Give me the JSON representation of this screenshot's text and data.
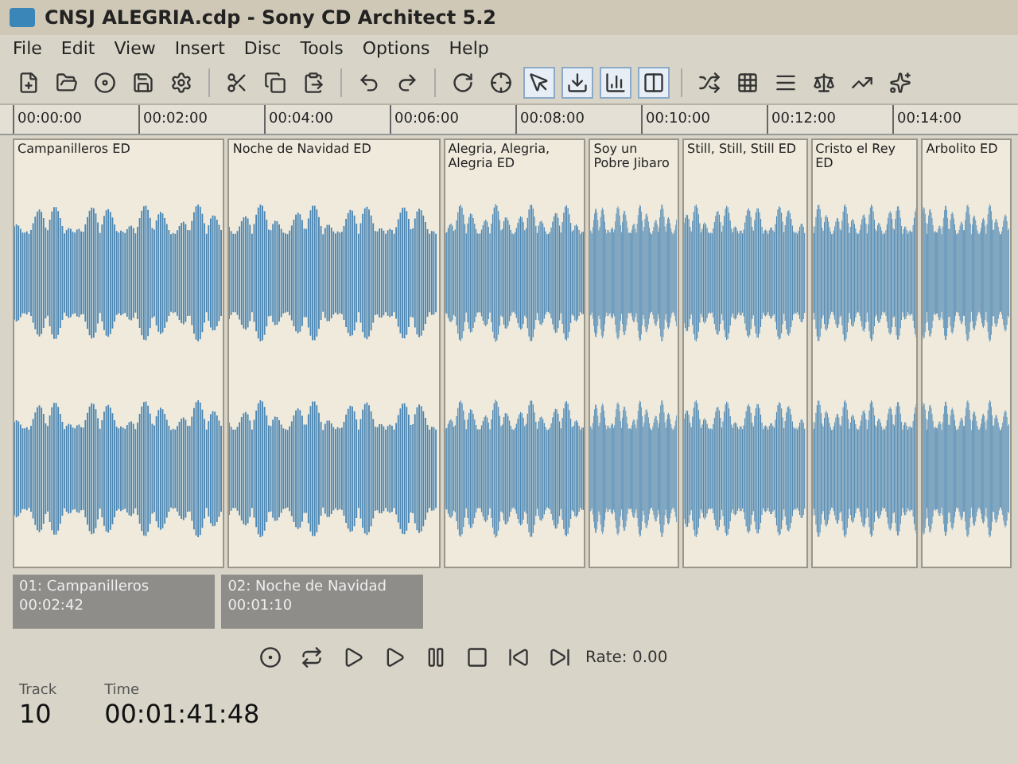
{
  "window": {
    "title": "CNSJ ALEGRIA.cdp - Sony CD Architect 5.2"
  },
  "menu": [
    "File",
    "Edit",
    "View",
    "Insert",
    "Disc",
    "Tools",
    "Options",
    "Help"
  ],
  "ruler": [
    "00:00:00",
    "00:02:00",
    "00:04:00",
    "00:06:00",
    "00:08:00",
    "00:10:00",
    "00:12:00",
    "00:14:00"
  ],
  "regions": [
    {
      "name": "Campanilleros ED"
    },
    {
      "name": "Noche de Navidad ED"
    },
    {
      "name": "Alegria, Alegria, Alegria ED"
    },
    {
      "name": "Soy un Pobre Jibaro"
    },
    {
      "name": "Still, Still, Still ED"
    },
    {
      "name": "Cristo el Rey ED"
    },
    {
      "name": "Arbolito ED"
    }
  ],
  "track_labels": [
    {
      "label": "01: Campanilleros",
      "time": "00:02:42"
    },
    {
      "label": "02: Noche de Navidad",
      "time": "00:01:10"
    }
  ],
  "transport": {
    "rate": "Rate: 0.00"
  },
  "status": {
    "track_label": "Track",
    "track": "10",
    "time_label": "Time",
    "time": "00:01:41:48"
  }
}
